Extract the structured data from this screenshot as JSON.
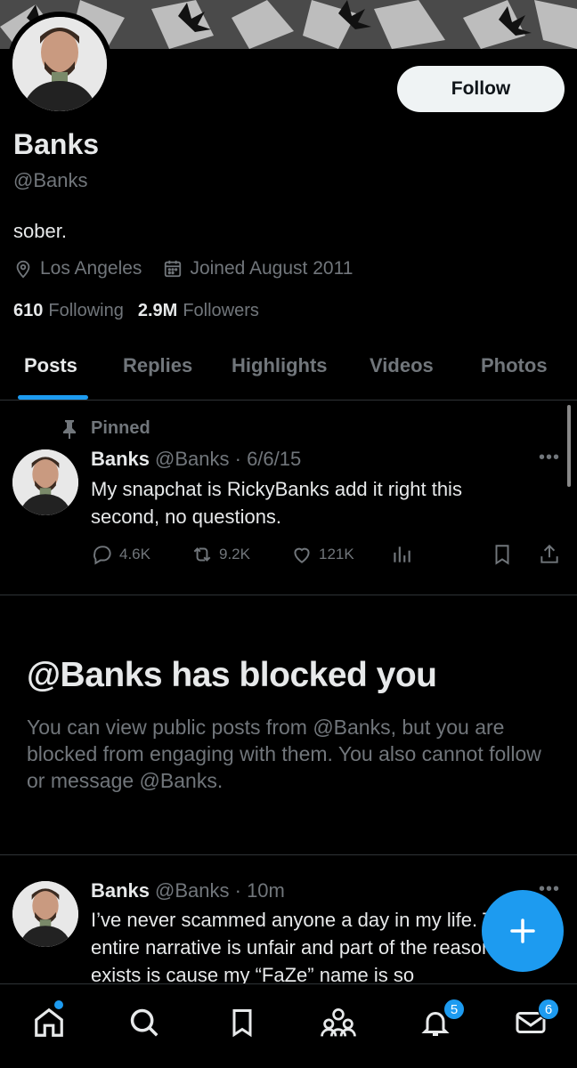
{
  "profile": {
    "follow_label": "Follow",
    "name": "Banks",
    "handle": "@Banks",
    "bio": "sober.",
    "location": "Los Angeles",
    "joined": "Joined August 2011",
    "following_count": "610",
    "following_label": "Following",
    "followers_count": "2.9M",
    "followers_label": "Followers"
  },
  "tabs": [
    {
      "label": "Posts",
      "active": true
    },
    {
      "label": "Replies",
      "active": false
    },
    {
      "label": "Highlights",
      "active": false
    },
    {
      "label": "Videos",
      "active": false
    },
    {
      "label": "Photos",
      "active": false
    }
  ],
  "pinned_post": {
    "pinned_label": "Pinned",
    "name": "Banks",
    "handle_date": "@Banks · 6/6/15",
    "text": "My snapchat is RickyBanks add it right this second, no questions.",
    "replies": "4.6K",
    "reposts": "9.2K",
    "likes": "121K"
  },
  "blocked": {
    "title": "@Banks has blocked you",
    "text": "You can view public posts from @Banks, but you are blocked from engaging with them. You also cannot follow or message @Banks."
  },
  "recent_post": {
    "name": "Banks",
    "handle_date": "@Banks · 10m",
    "text": "I’ve never scammed anyone a day in my life. The entire narrative is unfair and part of the reason it exists is cause my “FaZe” name is so"
  },
  "nav": {
    "notifications_badge": "5",
    "messages_badge": "6"
  },
  "colors": {
    "accent": "#1d9bf0",
    "background": "#000000",
    "muted_text": "#71767b"
  },
  "icons": [
    "location-icon",
    "calendar-icon",
    "pin-icon",
    "reply-icon",
    "repost-icon",
    "like-icon",
    "views-icon",
    "bookmark-icon",
    "share-icon",
    "more-icon",
    "compose-plus-icon",
    "home-icon",
    "search-icon",
    "bookmarks-icon",
    "communities-icon",
    "notifications-icon",
    "messages-icon"
  ]
}
